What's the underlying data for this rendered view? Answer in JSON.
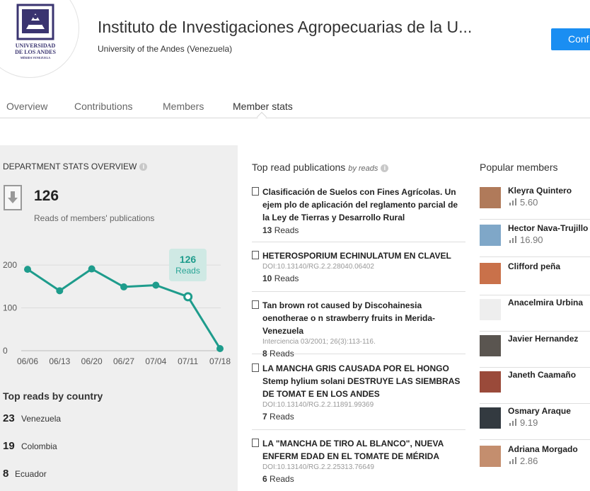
{
  "header": {
    "logo_lines": [
      "UNIVERSIDAD",
      "DE LOS ANDES",
      "MÉRIDA VENEZUELA"
    ],
    "title": "Instituto de Investigaciones Agropecuarias de la U...",
    "subtitle": "University of the Andes (Venezuela)",
    "follow_button": "Conf"
  },
  "tabs": [
    "Overview",
    "Contributions",
    "Members",
    "Member stats"
  ],
  "active_tab": "Member stats",
  "overview": {
    "heading": "DEPARTMENT STATS OVERVIEW",
    "total_reads": "126",
    "total_reads_label": "Reads of members' publications",
    "tooltip_value": "126",
    "tooltip_label": "Reads"
  },
  "chart_data": {
    "type": "line",
    "categories": [
      "06/06",
      "06/13",
      "06/20",
      "06/27",
      "07/04",
      "07/11",
      "07/18"
    ],
    "values": [
      190,
      140,
      191,
      149,
      153,
      126,
      5
    ],
    "ylim": [
      0,
      220
    ],
    "yticks": [
      "0",
      "100",
      "200"
    ],
    "highlighted_index": 5,
    "color": "#1e9c8c"
  },
  "countries": {
    "heading": "Top reads by country",
    "items": [
      {
        "count": "23",
        "name": "Venezuela"
      },
      {
        "count": "19",
        "name": "Colombia"
      },
      {
        "count": "8",
        "name": "Ecuador"
      }
    ]
  },
  "publications": {
    "heading": "Top read publications",
    "heading_suffix": "by reads",
    "reads_word": "Reads",
    "items": [
      {
        "title": "Clasificación de Suelos con Fines Agrícolas. Un ejem plo de aplicación del reglamento parcial de la Ley de Tierras y Desarrollo Rural",
        "meta": "",
        "reads": "13"
      },
      {
        "title": "HETEROSPORIUM ECHINULATUM EN CLAVEL",
        "meta": "DOI:10.13140/RG.2.2.28040.06402",
        "reads": "10"
      },
      {
        "title": "Tan brown rot caused by Discohainesia oenotherae o n strawberry fruits in Merida-Venezuela",
        "meta": "Interciencia 03/2001; 26(3):113-116.",
        "reads": "8"
      },
      {
        "title": "LA MANCHA GRIS CAUSADA POR EL HONGO Stemp hylium solani DESTRUYE LAS SIEMBRAS DE TOMAT E EN LOS ANDES",
        "meta": "DOI:10.13140/RG.2.2.11891.99369",
        "reads": "7"
      },
      {
        "title": "LA \"MANCHA DE TIRO AL BLANCO\", NUEVA ENFERM EDAD EN EL TOMATE DE MÉRIDA",
        "meta": "DOI:10.13140/RG.2.2.25313.76649",
        "reads": "6"
      }
    ]
  },
  "members": {
    "heading": "Popular members",
    "items": [
      {
        "name": "Kleyra Quintero",
        "score": "5.60",
        "avatar_color": "#b07a5a"
      },
      {
        "name": "Hector Nava-Trujillo",
        "score": "16.90",
        "avatar_color": "#7fa7c8"
      },
      {
        "name": "Clifford peña",
        "score": "",
        "avatar_color": "#c9714a"
      },
      {
        "name": "Anacelmira Urbina",
        "score": "",
        "avatar_color": "#eeeeee"
      },
      {
        "name": "Javier Hernandez",
        "score": "",
        "avatar_color": "#5a5550"
      },
      {
        "name": "Janeth Caamaño",
        "score": "",
        "avatar_color": "#9a4a3a"
      },
      {
        "name": "Osmary Araque",
        "score": "9.19",
        "avatar_color": "#333a40"
      },
      {
        "name": "Adriana Morgado",
        "score": "2.86",
        "avatar_color": "#c48e6e"
      }
    ]
  }
}
